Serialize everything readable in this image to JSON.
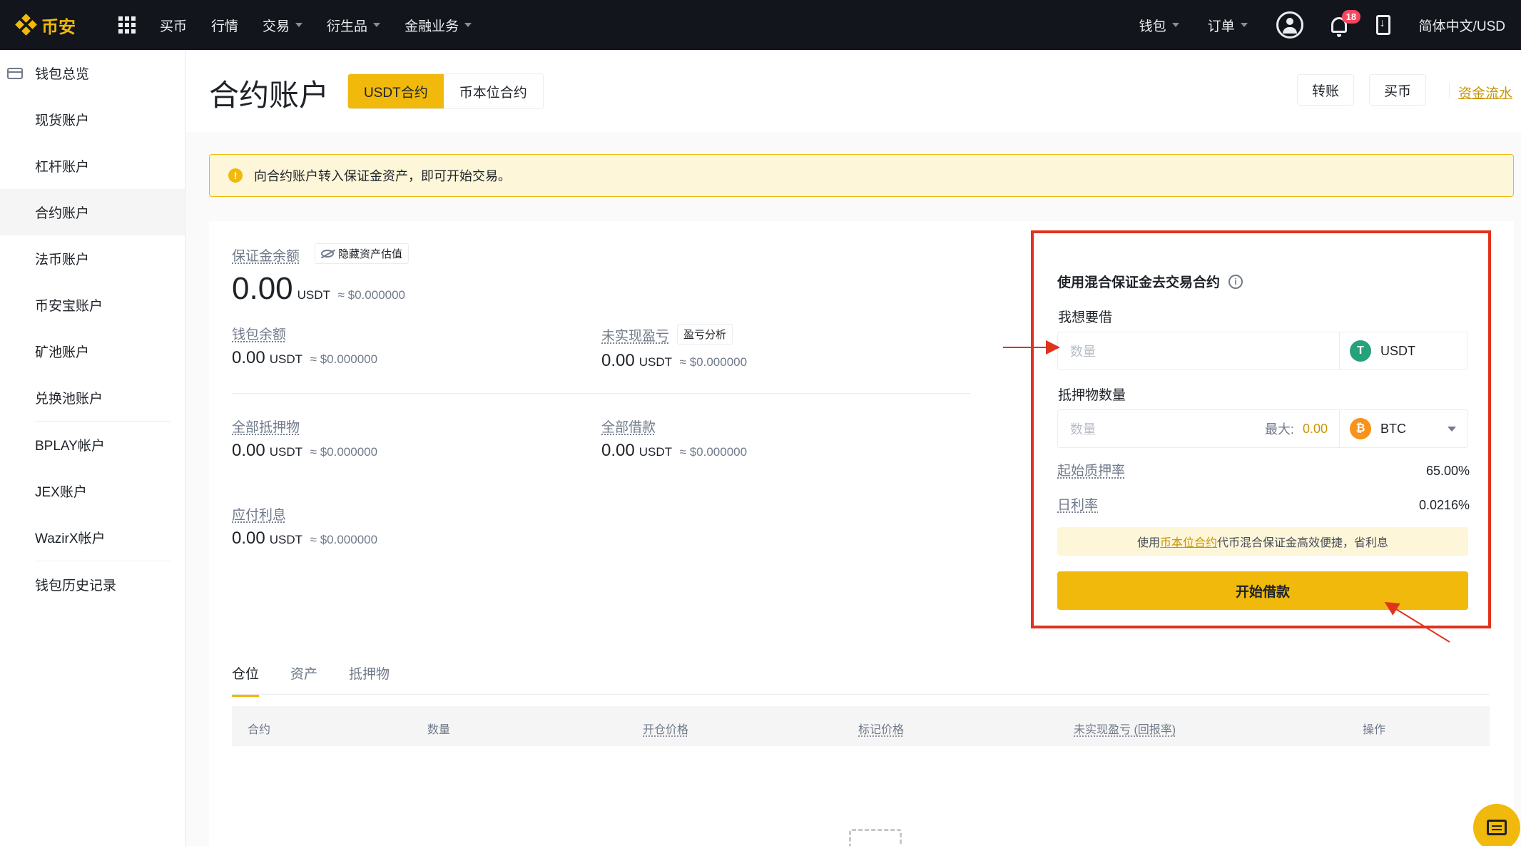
{
  "nav": {
    "logo_text": "币安",
    "items": [
      {
        "label": "买币",
        "caret": false
      },
      {
        "label": "行情",
        "caret": false
      },
      {
        "label": "交易",
        "caret": true
      },
      {
        "label": "衍生品",
        "caret": true
      },
      {
        "label": "金融业务",
        "caret": true
      }
    ],
    "wallet_label": "钱包",
    "orders_label": "订单",
    "notification_count": "18",
    "language_label": "简体中文/USD"
  },
  "sidebar": {
    "items": [
      {
        "label": "钱包总览"
      },
      {
        "label": "现货账户"
      },
      {
        "label": "杠杆账户"
      },
      {
        "label": "合约账户"
      },
      {
        "label": "法币账户"
      },
      {
        "label": "币安宝账户"
      },
      {
        "label": "矿池账户"
      },
      {
        "label": "兑换池账户"
      },
      {
        "label": "BPLAY帐户"
      },
      {
        "label": "JEX账户"
      },
      {
        "label": "WazirX帐户"
      },
      {
        "label": "钱包历史记录"
      }
    ],
    "active_index": 3
  },
  "header": {
    "title": "合约账户",
    "seg_active": "USDT合约",
    "seg_inactive": "币本位合约",
    "transfer_button": "转账",
    "buy_button": "买币",
    "funding_link": "资金流水"
  },
  "notice": {
    "text": "向合约账户转入保证金资产，即可开始交易。"
  },
  "summary": {
    "margin_balance_label": "保证金余额",
    "hide_label": "隐藏资产估值",
    "margin_balance_value": "0.00",
    "margin_balance_unit": "USDT",
    "margin_balance_fiat": "≈ $0.000000",
    "wallet_balance_label": "钱包余额",
    "wallet_balance_value": "0.00",
    "wallet_balance_unit": "USDT",
    "wallet_balance_fiat": "≈ $0.000000",
    "unrealized_label": "未实现盈亏",
    "pnl_analysis": "盈亏分析",
    "unrealized_value": "0.00",
    "unrealized_unit": "USDT",
    "unrealized_fiat": "≈ $0.000000",
    "collateral_label": "全部抵押物",
    "collateral_value": "0.00",
    "collateral_unit": "USDT",
    "collateral_fiat": "≈ $0.000000",
    "loan_label": "全部借款",
    "loan_value": "0.00",
    "loan_unit": "USDT",
    "loan_fiat": "≈ $0.000000",
    "interest_label": "应付利息",
    "interest_value": "0.00",
    "interest_unit": "USDT",
    "interest_fiat": "≈ $0.000000"
  },
  "borrow": {
    "title": "使用混合保证金去交易合约",
    "borrow_label": "我想要借",
    "borrow_placeholder": "数量",
    "borrow_coin": "USDT",
    "collateral_label": "抵押物数量",
    "collateral_placeholder": "数量",
    "max_label": "最大:",
    "max_value": "0.00",
    "collateral_coin": "BTC",
    "initial_ltv_label": "起始质押率",
    "initial_ltv_value": "65.00%",
    "daily_rate_label": "日利率",
    "daily_rate_value": "0.0216%",
    "tip_prefix": "使用",
    "tip_link": "币本位合约",
    "tip_suffix": "代币混合保证金高效便捷，省利息",
    "start_button": "开始借款"
  },
  "tabs": [
    "仓位",
    "资产",
    "抵押物"
  ],
  "table": {
    "columns": [
      "合约",
      "数量",
      "开仓价格",
      "标记价格",
      "未实现盈亏 (回报率)",
      "操作"
    ]
  },
  "colors": {
    "brand": "#f0b90b",
    "highlight_box": "#e0331c"
  }
}
